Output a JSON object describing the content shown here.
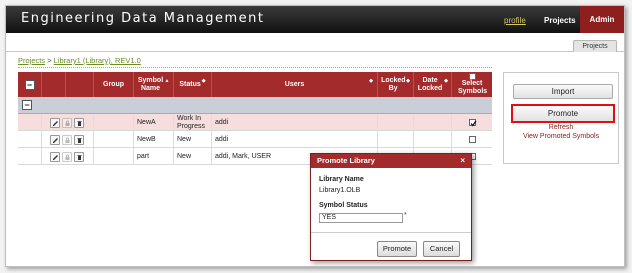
{
  "header": {
    "app_title": "Engineering Data Management",
    "nav": {
      "profile": "profile",
      "projects": "Projects",
      "admin": "Admin"
    }
  },
  "tabs": {
    "projects_tab": "Projects"
  },
  "breadcrumb": {
    "projects": "Projects",
    "separator": ">",
    "library": "Library1 (Library), REV1.0"
  },
  "grid": {
    "columns": [
      "Group",
      "Symbol Name",
      "Status",
      "Users",
      "Locked By",
      "Date Locked",
      "Select Symbols"
    ],
    "rows": [
      {
        "symbol": "NewA",
        "status": "Work In Progress",
        "users": "addi",
        "locked_by": "",
        "date_locked": "",
        "selected": true
      },
      {
        "symbol": "NewB",
        "status": "New",
        "users": "addi",
        "locked_by": "",
        "date_locked": "",
        "selected": false
      },
      {
        "symbol": "part",
        "status": "New",
        "users": "addi, Mark, USER",
        "locked_by": "",
        "date_locked": "",
        "selected": false
      }
    ]
  },
  "side_actions": {
    "import": "Import",
    "promote": "Promote",
    "refresh": "Refresh",
    "view_promoted": "View Promoted Symbols"
  },
  "dialog": {
    "title": "Promote Library",
    "close": "×",
    "library_name_label": "Library Name",
    "library_name_value": "Library1.OLB",
    "symbol_status_label": "Symbol Status",
    "symbol_status_value": "YES",
    "required_mark": "*",
    "promote_button": "Promote",
    "cancel_button": "Cancel"
  },
  "colors": {
    "header_bg": "#111111",
    "accent_red": "#a32b2b",
    "admin_tab": "#8e1f1f",
    "link_green": "#6b8e23",
    "highlight_border": "#e01010"
  }
}
